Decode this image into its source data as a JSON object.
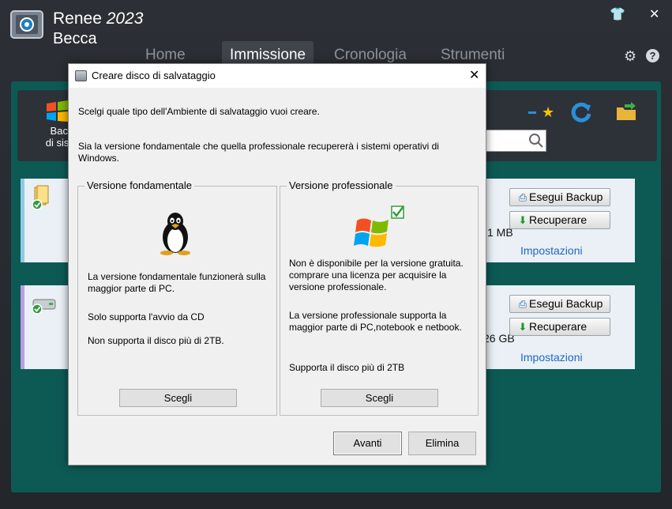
{
  "app": {
    "brand_name": "Renee",
    "brand_year": "2023",
    "brand_product": "Becca",
    "shirt_glyph": "👕",
    "close_glyph": "✕"
  },
  "nav": {
    "tabs": [
      "Home",
      "Immissione",
      "Cronologia",
      "Strumenti"
    ],
    "active_tab": "Immissione",
    "settings_glyph": "⚙",
    "help_glyph": "?"
  },
  "toolbar": {
    "backup_label_line1": "Back",
    "backup_label_line2": "di siste",
    "search_glyph": "🔍"
  },
  "cards": [
    {
      "size_text": "1 MB",
      "backup_button": "Esegui Backup",
      "restore_button": "Recuperare",
      "settings_link": "Impostazioni",
      "accent_color": "#8ecae6"
    },
    {
      "size_text": "26 GB",
      "backup_button": "Esegui Backup",
      "restore_button": "Recuperare",
      "settings_link": "Impostazioni",
      "accent_color": "#b8a0e0"
    }
  ],
  "dialog": {
    "title": "Creare disco di salvataggio",
    "close_glyph": "✕",
    "intro": "Scelgi quale tipo dell'Ambiente di salvataggio vuoi creare.",
    "description": "Sia la versione fondamentale che quella professionale recupererà i sistemi operativi di Windows.",
    "basic": {
      "title": "Versione fondamentale",
      "line1": "La versione fondamentale funzionerà sulla maggior parte di PC.",
      "line2": "Solo supporta l'avvio da CD",
      "line3": "Non supporta il disco più di 2TB.",
      "button": "Scegli"
    },
    "pro": {
      "title": "Versione professionale",
      "line1": "Non è disponibile per la versione gratuita. comprare una licenza per acquisire la versione professionale.",
      "line2": "La versione professionale supporta la maggior parte di PC,notebook e netbook.",
      "line3": "Supporta il disco più di 2TB",
      "button": "Scegli"
    },
    "next_button": "Avanti",
    "cancel_button": "Elimina"
  }
}
